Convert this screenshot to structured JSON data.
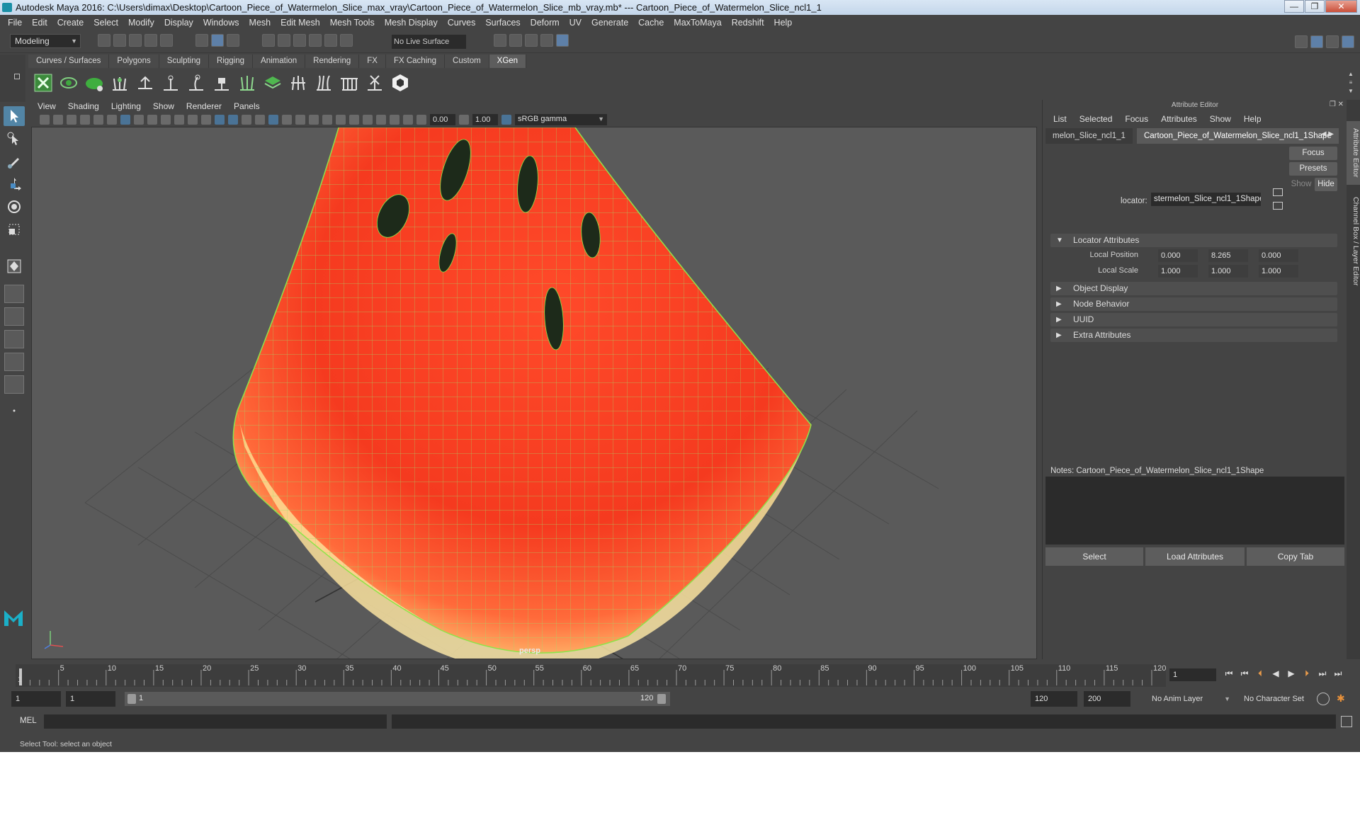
{
  "window": {
    "title": "Autodesk Maya 2016: C:\\Users\\dimax\\Desktop\\Cartoon_Piece_of_Watermelon_Slice_max_vray\\Cartoon_Piece_of_Watermelon_Slice_mb_vray.mb*   ---   Cartoon_Piece_of_Watermelon_Slice_ncl1_1",
    "minimize": "—",
    "maximize": "❐",
    "close": "✕"
  },
  "menubar": [
    "File",
    "Edit",
    "Create",
    "Select",
    "Modify",
    "Display",
    "Windows",
    "Mesh",
    "Edit Mesh",
    "Mesh Tools",
    "Mesh Display",
    "Curves",
    "Surfaces",
    "Deform",
    "UV",
    "Generate",
    "Cache",
    "MaxToMaya",
    "Redshift",
    "Help"
  ],
  "statusline": {
    "mode": "Modeling",
    "live_surface": "No Live Surface"
  },
  "shelf": {
    "tabs": [
      "Curves / Surfaces",
      "Polygons",
      "Sculpting",
      "Rigging",
      "Animation",
      "Rendering",
      "FX",
      "FX Caching",
      "Custom",
      "XGen"
    ],
    "active_tab": "XGen"
  },
  "panel_menu": [
    "View",
    "Shading",
    "Lighting",
    "Show",
    "Renderer",
    "Panels"
  ],
  "viewport_toolbar": {
    "exposure": "0.00",
    "gamma": "1.00",
    "color_space": "sRGB gamma"
  },
  "viewport": {
    "camera_label": "persp",
    "axis_x": "x",
    "axis_y": "y"
  },
  "attribute_editor": {
    "title": "Attribute Editor",
    "menu": [
      "List",
      "Selected",
      "Focus",
      "Attributes",
      "Show",
      "Help"
    ],
    "tabs": [
      "melon_Slice_ncl1_1",
      "Cartoon_Piece_of_Watermelon_Slice_ncl1_1Shape"
    ],
    "locator_label": "locator:",
    "locator_value": "stermelon_Slice_ncl1_1Shape",
    "buttons": {
      "focus": "Focus",
      "presets": "Presets",
      "show": "Show",
      "hide": "Hide"
    },
    "sections": {
      "locator_attributes": "Locator Attributes",
      "object_display": "Object Display",
      "node_behavior": "Node Behavior",
      "uuid": "UUID",
      "extra_attributes": "Extra Attributes"
    },
    "local_position": {
      "label": "Local Position",
      "x": "0.000",
      "y": "8.265",
      "z": "0.000"
    },
    "local_scale": {
      "label": "Local Scale",
      "x": "1.000",
      "y": "1.000",
      "z": "1.000"
    },
    "notes_label": "Notes:  Cartoon_Piece_of_Watermelon_Slice_ncl1_1Shape",
    "bottom_buttons": {
      "select": "Select",
      "load": "Load Attributes",
      "copy": "Copy Tab"
    }
  },
  "side_tabs": [
    "Attribute Editor",
    "Channel Box / Layer Editor"
  ],
  "timeline": {
    "ticks": [
      "5",
      "10",
      "15",
      "20",
      "25",
      "30",
      "35",
      "40",
      "45",
      "50",
      "55",
      "60",
      "65",
      "70",
      "75",
      "80",
      "85",
      "90",
      "95",
      "100",
      "105",
      "110",
      "115",
      "120"
    ],
    "start_label": "1",
    "current_frame": "1"
  },
  "range": {
    "start": "1",
    "playback_start": "1",
    "range_start_label": "1",
    "range_end_label": "120",
    "playback_end": "120",
    "end": "200",
    "anim_layer": "No Anim Layer",
    "character_set": "No Character Set"
  },
  "command_line": {
    "label": "MEL"
  },
  "help_line": "Select Tool: select an object"
}
